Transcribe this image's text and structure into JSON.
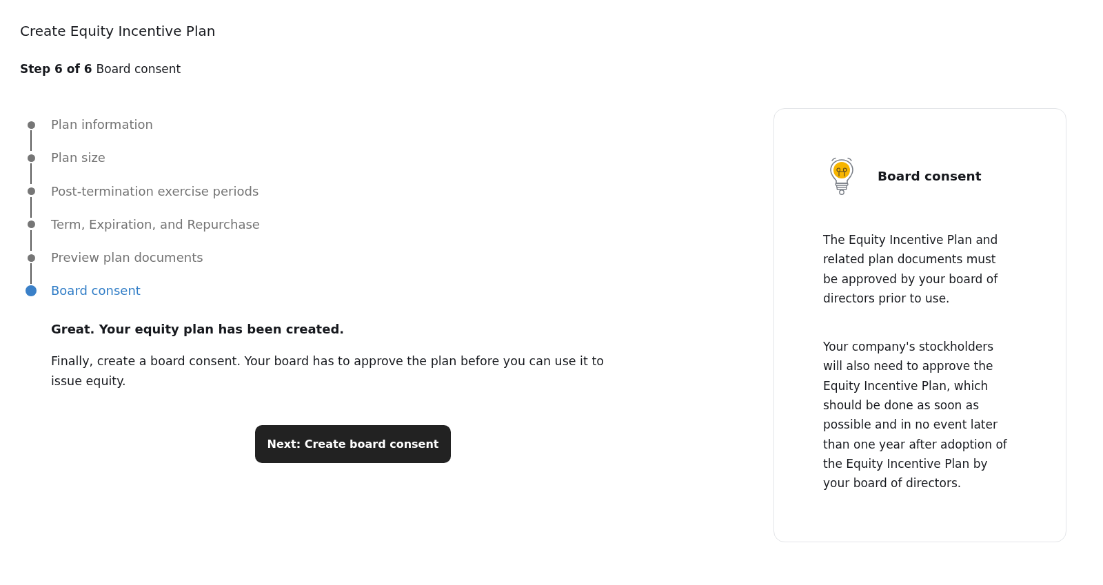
{
  "page": {
    "title": "Create Equity Incentive Plan",
    "step_label": "Step 6 of 6",
    "step_name": "Board consent"
  },
  "steps": [
    {
      "label": "Plan information",
      "selected": false
    },
    {
      "label": "Plan size",
      "selected": false
    },
    {
      "label": "Post-termination exercise periods",
      "selected": false
    },
    {
      "label": "Term, Expiration, and Repurchase",
      "selected": false
    },
    {
      "label": "Preview plan documents",
      "selected": false
    },
    {
      "label": "Board consent",
      "selected": true
    }
  ],
  "message": {
    "heading": "Great. Your equity plan has been created.",
    "body": "Finally, create a board consent. Your board has to approve the plan before you can use it to issue equity.",
    "button": "Next: Create board consent"
  },
  "info_card": {
    "title": "Board consent",
    "paragraphs": [
      "The Equity Incentive Plan and related plan documents must be approved by your board of directors prior to use.",
      "Your company's stockholders will also need to approve the Equity Incentive Plan, which should be done as soon as possible and in no event later than one year after adoption of the Equity Incentive Plan by your board of directors."
    ]
  }
}
